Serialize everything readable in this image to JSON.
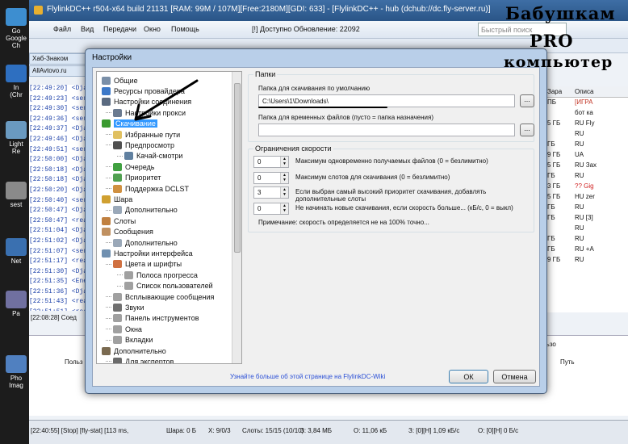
{
  "main_window": {
    "title": "FlylinkDC++ r504-x64 build 21131 [RAM: 99M / 107M][Free:2180M][GDI: 633] - [FlylinkDC++ - hub (dchub://dc.fly-server.ru)]",
    "menu": [
      "Файл",
      "Вид",
      "Передачи",
      "Окно",
      "Помощь"
    ],
    "update_notice": "[!] Доступно Обновление: 22092",
    "quick_search_placeholder": "Быстрый поиск",
    "tabs": [
      "Хаб-Знаком",
      "AllAvtovo.ru"
    ],
    "chat_lines": [
      "[22:49:20] <Dja",
      "[22:49:23] <ser",
      "[22:49:30] <ser",
      "[22:49:36] <ser",
      "[22:49:37] <Dja",
      "[22:49:46] <Dja",
      "[22:49:51] <ser",
      "[22:50:00] <Dja",
      "[22:50:18] <Dja",
      "[22:50:18] <Dja",
      "[22:50:20] <Dja",
      "[22:50:40] <ser",
      "[22:50:47] <Dja",
      "[22:50:47] <rea",
      "[22:51:04] <Dja",
      "[22:51:02] <Dja",
      "[22:51:07] <ser",
      "[22:51:17] <rea",
      "[22:51:30] <Dja",
      "[22:51:35] <Ene",
      "[22:51:36] <Dja",
      "[22:51:43] <rea",
      "[22:51:51] <rea"
    ],
    "last_chat_line": "[22:08:28] Соед",
    "right_headers": [
      "Зара",
      "Описа"
    ],
    "right_rows": [
      [
        "ПБ",
        "[ИГРА"
      ],
      [
        "",
        "бот ка"
      ],
      [
        "5 ГБ",
        "RU Fly"
      ],
      [
        "",
        "RU"
      ],
      [
        "ГБ",
        "RU"
      ],
      [
        "9 ГБ",
        "UA"
      ],
      [
        "5 ГБ",
        "RU Зах"
      ],
      [
        "ГБ",
        "RU"
      ],
      [
        "3 ГБ",
        "?? Gig"
      ],
      [
        "5 ГБ",
        "HU zer"
      ],
      [
        "ГБ",
        "RU"
      ],
      [
        "ГБ",
        "RU [3]"
      ],
      [
        "",
        "RU"
      ],
      [
        "ГБ",
        "RU"
      ],
      [
        "ГБ",
        "RU +A"
      ],
      [
        "9 ГБ",
        "RU"
      ]
    ],
    "bottom_cols": [
      "Польз",
      "Путь"
    ],
    "bottom_right": "льзо",
    "status": [
      "[22:40:55] [Stop] [fly-stat] [113 ms,",
      "Шара: 0 Б",
      "Х: 9/0/3",
      "Слоты: 15/15 (10/10)",
      "З: 3,84 МБ",
      "О: 11,06 кБ",
      "З: [0][Н] 1,09 кБ/с",
      "О: [0][Н] 0 Б/с"
    ]
  },
  "desktop_icons": [
    "Go\nGoogle\nCh",
    "In\n(Chr",
    "Light\nRe",
    "sest",
    "Net",
    "Pa",
    "Pho\nImag"
  ],
  "dialog": {
    "title": "Настройки",
    "tree": [
      {
        "label": "Общие",
        "level": 1,
        "icon": "general-icon",
        "color": "#7a8fa8"
      },
      {
        "label": "Ресурсы провайдера",
        "level": 1,
        "icon": "provider-icon",
        "color": "#3c78c8"
      },
      {
        "label": "Настройки соединения",
        "level": 1,
        "icon": "connection-icon",
        "color": "#5a6a80"
      },
      {
        "label": "Настройки прокси",
        "level": 2,
        "icon": "proxy-icon",
        "color": "#6a7a90"
      },
      {
        "label": "Скачивание",
        "level": 1,
        "icon": "download-icon",
        "color": "#3a9a30",
        "selected": true
      },
      {
        "label": "Избранные пути",
        "level": 2,
        "icon": "favorite-paths-icon",
        "color": "#e0c060"
      },
      {
        "label": "Предпросмотр",
        "level": 2,
        "icon": "preview-icon",
        "color": "#505050"
      },
      {
        "label": "Качай-смотри",
        "level": 3,
        "icon": "download-watch-icon",
        "color": "#6080a0"
      },
      {
        "label": "Очередь",
        "level": 2,
        "icon": "queue-icon",
        "color": "#40a040"
      },
      {
        "label": "Приоритет",
        "level": 2,
        "icon": "priority-icon",
        "color": "#50a050"
      },
      {
        "label": "Поддержка DCLST",
        "level": 2,
        "icon": "dclst-icon",
        "color": "#d09040"
      },
      {
        "label": "Шара",
        "level": 1,
        "icon": "share-icon",
        "color": "#d0a030"
      },
      {
        "label": "Дополнительно",
        "level": 2,
        "icon": "advanced-icon",
        "color": "#9aa8b8"
      },
      {
        "label": "Слоты",
        "level": 1,
        "icon": "slots-icon",
        "color": "#c08040"
      },
      {
        "label": "Сообщения",
        "level": 1,
        "icon": "messages-icon",
        "color": "#c09060"
      },
      {
        "label": "Дополнительно",
        "level": 2,
        "icon": "advanced-icon",
        "color": "#9aa8b8"
      },
      {
        "label": "Настройки интерфейса",
        "level": 1,
        "icon": "interface-icon",
        "color": "#7090b0"
      },
      {
        "label": "Цвета и шрифты",
        "level": 2,
        "icon": "colors-icon",
        "color": "#d07040"
      },
      {
        "label": "Полоса прогресса",
        "level": 3,
        "icon": "progress-icon",
        "color": "#a0a0a0"
      },
      {
        "label": "Список пользователей",
        "level": 3,
        "icon": "userlist-icon",
        "color": "#a0a0a0"
      },
      {
        "label": "Всплывающие сообщения",
        "level": 2,
        "icon": "popup-icon",
        "color": "#a0a0a0"
      },
      {
        "label": "Звуки",
        "level": 2,
        "icon": "sounds-icon",
        "color": "#707070"
      },
      {
        "label": "Панель инструментов",
        "level": 2,
        "icon": "toolbar-icon",
        "color": "#a0a0a0"
      },
      {
        "label": "Окна",
        "level": 2,
        "icon": "windows-icon",
        "color": "#a0a0a0"
      },
      {
        "label": "Вкладки",
        "level": 2,
        "icon": "tabs-icon",
        "color": "#a0a0a0"
      },
      {
        "label": "Дополнительно",
        "level": 1,
        "icon": "tools-icon",
        "color": "#7a6a50"
      },
      {
        "label": "Для экспертов",
        "level": 2,
        "icon": "expert-icon",
        "color": "#6a6a6a"
      }
    ],
    "folders_legend": "Папки",
    "download_folder_label": "Папка для скачивания по умолчанию",
    "download_folder_value": "C:\\Users\\1\\Downloads\\",
    "browse_label": "...",
    "temp_folder_label": "Папка для временных файлов (пусто = папка назначения)",
    "temp_folder_value": "",
    "limits_legend": "Ограничения скорости",
    "limits": [
      {
        "value": "0",
        "label": "Максимум одновременно получаемых файлов (0 = безлимитно)"
      },
      {
        "value": "0",
        "label": "Максимум слотов для скачивания (0 = безлимитно)"
      },
      {
        "value": "3",
        "label": "Если выбран самый высокий приоритет скачивания, добавлять дополнительные слоты"
      },
      {
        "value": "0",
        "label": "Не начинать новые скачивания, если скорость больше... (кБ/с, 0 = выкл)"
      }
    ],
    "note": "Примечание: скорость определяется не на 100% точно...",
    "wiki_link": "Узнайте больше об этой странице на FlylinkDC-Wiki",
    "ok_label": "ОК",
    "cancel_label": "Отмена"
  },
  "annotation": {
    "line1": "Бабушкам",
    "line2": "PRO",
    "line3": "компьютер"
  }
}
